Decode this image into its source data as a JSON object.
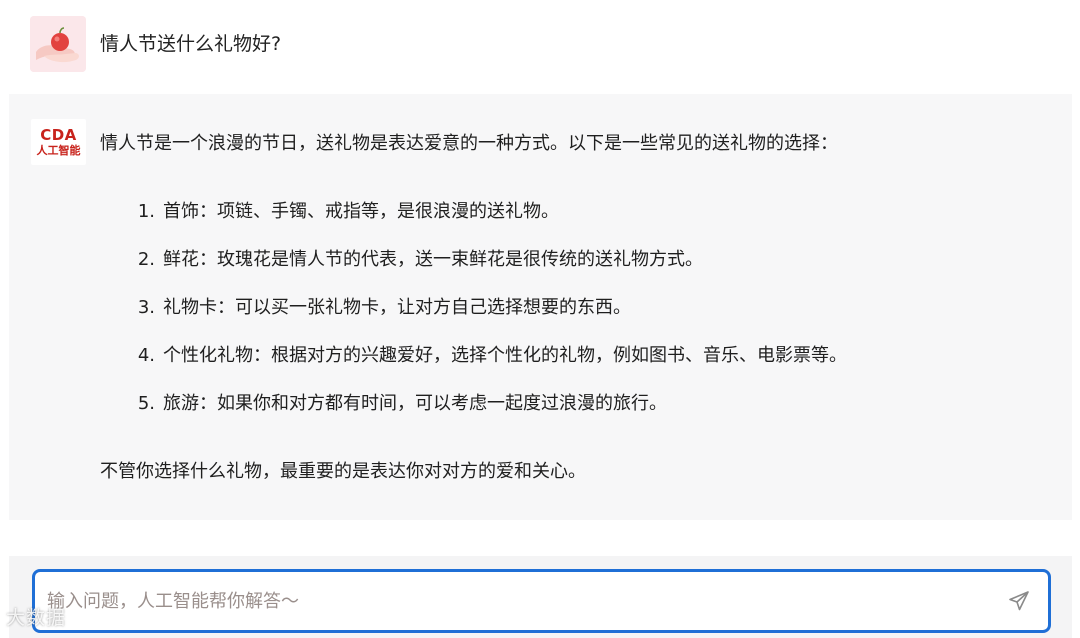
{
  "question": {
    "avatar_icon": "hand-holding-heart-icon",
    "text": "情人节送什么礼物好?"
  },
  "answer": {
    "avatar_logo_top": "CDA",
    "avatar_logo_bottom": "人工智能",
    "brand_color": "#c8231c",
    "intro": "情人节是一个浪漫的节日，送礼物是表达爱意的一种方式。以下是一些常见的送礼物的选择：",
    "items": [
      {
        "num": "1.",
        "text": "首饰：项链、手镯、戒指等，是很浪漫的送礼物。"
      },
      {
        "num": "2.",
        "text": "鲜花：玫瑰花是情人节的代表，送一束鲜花是很传统的送礼物方式。"
      },
      {
        "num": "3.",
        "text": "礼物卡：可以买一张礼物卡，让对方自己选择想要的东西。"
      },
      {
        "num": "4.",
        "text": "个性化礼物：根据对方的兴趣爱好，选择个性化的礼物，例如图书、音乐、电影票等。"
      },
      {
        "num": "5.",
        "text": "旅游：如果你和对方都有时间，可以考虑一起度过浪漫的旅行。"
      }
    ],
    "outro": "不管你选择什么礼物，最重要的是表达你对对方的爱和关心。"
  },
  "input": {
    "placeholder": "输入问题，人工智能帮你解答～",
    "value": "",
    "accent_color": "#1f6fd6",
    "send_icon": "send-icon"
  },
  "watermark": "大数据"
}
